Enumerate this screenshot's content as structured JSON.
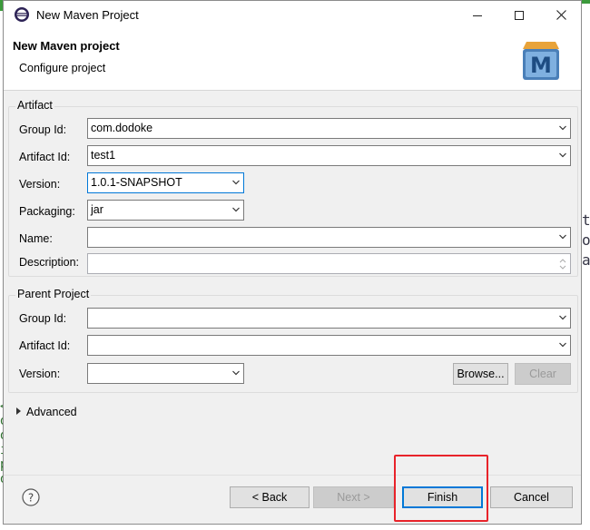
{
  "window": {
    "title": "New Maven Project",
    "minimize_icon": "minimize-icon",
    "maximize_icon": "maximize-icon",
    "close_icon": "close-icon"
  },
  "header": {
    "title": "New Maven project",
    "subtitle": "Configure project",
    "logo_letter": "M"
  },
  "artifact": {
    "legend": "Artifact",
    "group_id": {
      "label": "Group Id:",
      "value": "com.dodoke"
    },
    "artifact_id": {
      "label": "Artifact Id:",
      "value": "test1"
    },
    "version": {
      "label": "Version:",
      "value": "1.0.1-SNAPSHOT"
    },
    "packaging": {
      "label": "Packaging:",
      "value": "jar"
    },
    "name": {
      "label": "Name:",
      "value": ""
    },
    "description": {
      "label": "Description:",
      "value": ""
    }
  },
  "parent": {
    "legend": "Parent Project",
    "group_id": {
      "label": "Group Id:",
      "value": ""
    },
    "artifact_id": {
      "label": "Artifact Id:",
      "value": ""
    },
    "version": {
      "label": "Version:",
      "value": ""
    },
    "browse_label": "Browse...",
    "clear_label": "Clear"
  },
  "advanced": {
    "label": "Advanced"
  },
  "footer": {
    "back_label": "< Back",
    "next_label": "Next >",
    "finish_label": "Finish",
    "cancel_label": "Cancel"
  },
  "colors": {
    "accent": "#0078d7",
    "highlight": "#e8232a",
    "dialog_bg": "#f0f0f0"
  }
}
